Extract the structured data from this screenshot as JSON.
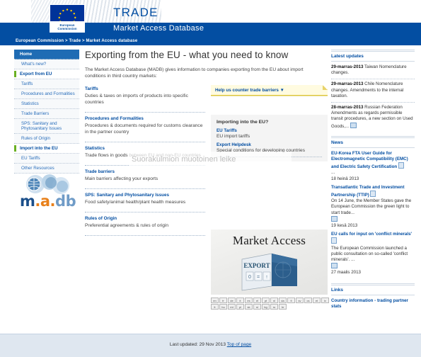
{
  "header": {
    "logo_alt": "European Commission",
    "ec_line1": "European",
    "ec_line2": "Commission",
    "trade_title": "TRADE",
    "subtitle": "Market Access Database",
    "breadcrumb": "European Commission > Trade > Market Access database"
  },
  "sidebar": {
    "items": [
      {
        "label": "Home",
        "type": "active"
      },
      {
        "label": "What's new?",
        "type": "sub"
      },
      {
        "label": "Export from EU",
        "type": "head"
      },
      {
        "label": "Tariffs",
        "type": "sub"
      },
      {
        "label": "Procedures and Formalities",
        "type": "sub"
      },
      {
        "label": "Statistics",
        "type": "sub"
      },
      {
        "label": "Trade Barriers",
        "type": "sub"
      },
      {
        "label": "SPS: Sanitary and Phytosanitary Issues",
        "type": "sub"
      },
      {
        "label": "Rules of Origin",
        "type": "sub"
      },
      {
        "label": "Import into the EU",
        "type": "head"
      },
      {
        "label": "EU Tariffs",
        "type": "sub"
      },
      {
        "label": "Other Resources",
        "type": "sub"
      }
    ],
    "logo": {
      "m": "m",
      "a": "a",
      "dot1": ".",
      "db": "db"
    }
  },
  "main": {
    "title": "Exporting from the EU - what you need to know",
    "intro": "The Market Access Database (MADB) gives information to companies exporting from the EU about import conditions in third country markets:",
    "sections": [
      {
        "title": "Tariffs",
        "body": "Duties & taxes on imports of products into specific countries"
      },
      {
        "title": "Procedures and Formalities",
        "body": "Procedures & documents required for customs clearance in the partner country"
      },
      {
        "title": "Statistics",
        "body": "Trade flows in goods between EU and non-EU countries"
      },
      {
        "title": "Trade barriers",
        "body": "Main barriers affecting your exports"
      },
      {
        "title": "SPS: Sanitary and Phytosanitary Issues",
        "body": "Food safety/animal health/plant health measures"
      },
      {
        "title": "Rules of Origin",
        "body": "Preferential agreements & rules of origin"
      }
    ],
    "watermark": "Suorakulmion muotoinen leike"
  },
  "promo": {
    "banner_label": "Help us counter trade barriers ▼",
    "box_title": "Importing into the EU?",
    "links": [
      {
        "label": "EU Tariffs",
        "text": "EU import tariffs"
      },
      {
        "label": "Export Helpdesk",
        "text": "Special conditions for developing countries"
      }
    ],
    "image_title": "Market Access",
    "image_box_label": "EXPORT",
    "languages": [
      "en",
      "fr",
      "de",
      "it",
      "es",
      "el",
      "pt",
      "nl",
      "da",
      "fi",
      "sv",
      "cs",
      "et",
      "lv",
      "lt",
      "hu",
      "mt",
      "pl",
      "sk",
      "sl",
      "bg",
      "ro",
      "hr"
    ]
  },
  "updates": {
    "heading": "Latest updates",
    "items": [
      {
        "date": "29-marras-2013",
        "text": "Taiwan Nomenclature changes."
      },
      {
        "date": "29-marras-2013",
        "text": "Chile Nomenclature changes. Amendments to the internal taxation."
      },
      {
        "date": "28-marras-2013",
        "text": "Russian Federation Amendments as regards permissible transit procedures, a new section on Used Goods,...",
        "more": true
      }
    ]
  },
  "news": {
    "heading": "News",
    "items": [
      {
        "title": "EU-Korea FTA User Guide for Electromagnetic Compatibility (EMC) and Electric Safety Certification",
        "pdf": true,
        "desc": "...",
        "date": "18 heinä 2013"
      },
      {
        "title": "Transatlantic Trade and Investment Partnership (TTIP)",
        "pdf": true,
        "desc": "On 14 June, the Member States gave the European Commission the green light to start trade...",
        "more": true,
        "date": "19 kesä 2013"
      },
      {
        "title": "EU calls for input on 'conflict minerals'",
        "pdf": true,
        "desc": "The European Commission launched a public consultation on so-called 'conflict minerals'. ...",
        "more": true,
        "date": "27 maalis 2013"
      }
    ]
  },
  "links": {
    "heading": "Links",
    "items": [
      {
        "label": "Country information - trading partner stats"
      }
    ]
  },
  "footer": {
    "last_updated": "Last updated:  29 Nov 2013",
    "top_link": "Top of page"
  },
  "colors": {
    "eu_blue": "#034ea2",
    "link_blue": "#2a6ebb",
    "green_accent": "#6ab023",
    "yellow_banner": "#fffbe0",
    "footer_bg": "#dfe7f0"
  }
}
